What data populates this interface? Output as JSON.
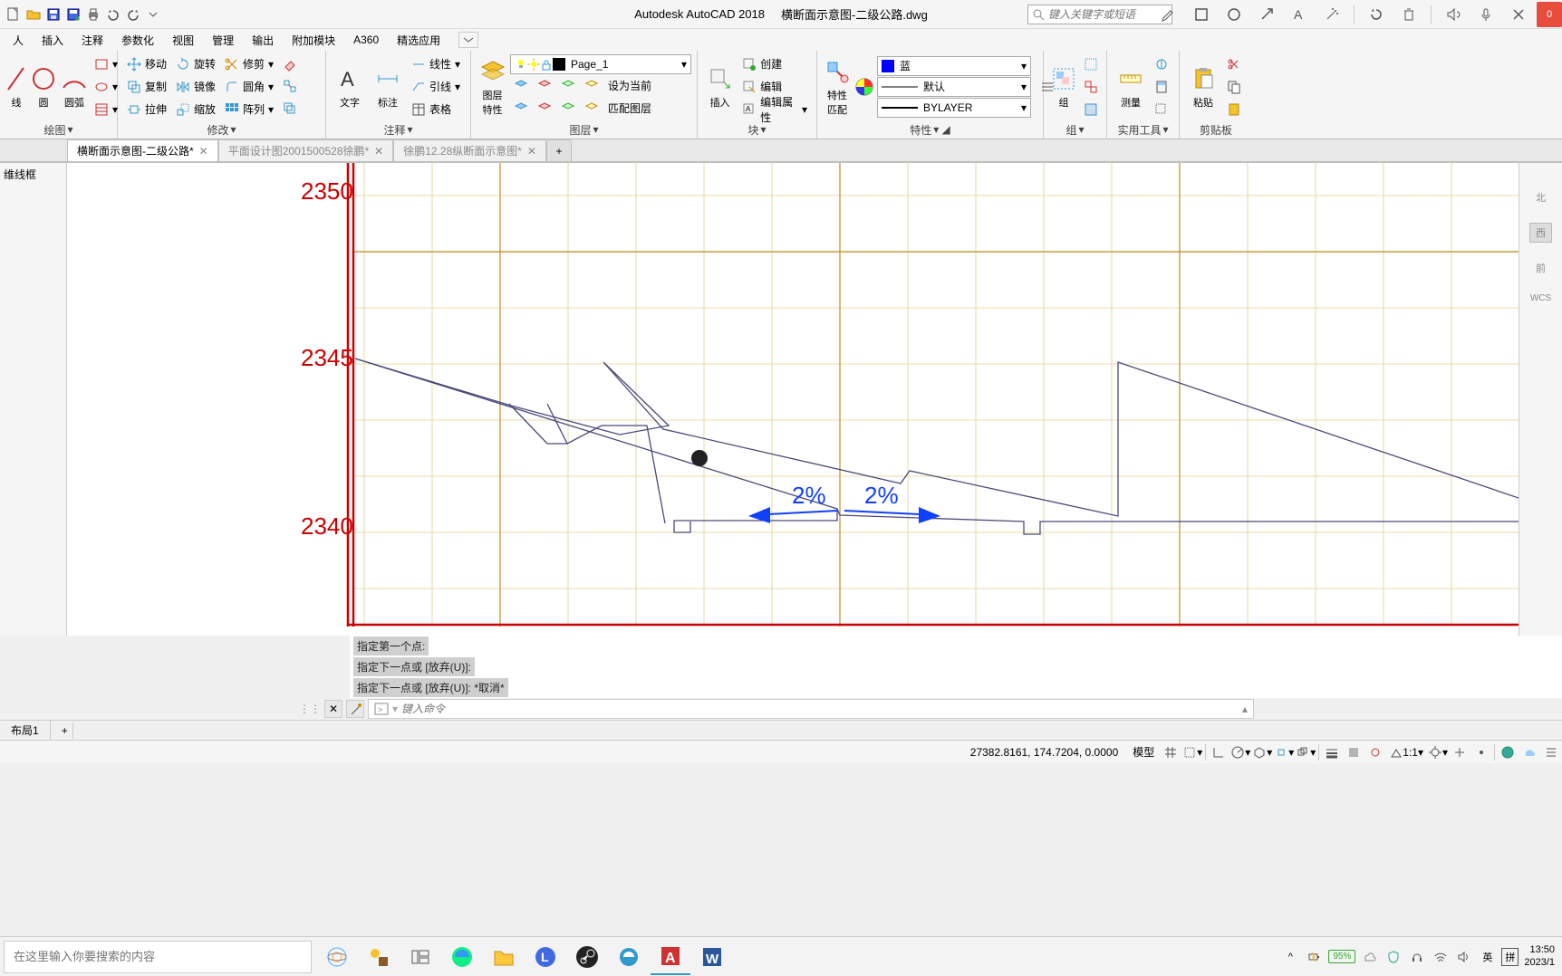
{
  "title": {
    "app": "Autodesk AutoCAD 2018",
    "doc": "横断面示意图-二级公路.dwg"
  },
  "search_placeholder": "键入关键字或短语",
  "badge": "0",
  "menu": [
    "人",
    "插入",
    "注释",
    "参数化",
    "视图",
    "管理",
    "输出",
    "附加模块",
    "A360",
    "精选应用"
  ],
  "ribbon": {
    "draw": {
      "title": "绘图",
      "line": "线",
      "circle": "圆",
      "arc": "圆弧"
    },
    "modify": {
      "title": "修改",
      "items": [
        "移动",
        "旋转",
        "修剪",
        "复制",
        "镜像",
        "圆角",
        "拉伸",
        "缩放",
        "阵列"
      ]
    },
    "annot": {
      "title": "注释",
      "text": "文字",
      "dim": "标注",
      "table": "表格",
      "xline": "线性",
      "leader": "引线"
    },
    "layer": {
      "title": "图层",
      "props": "图层\n特性",
      "items": [
        "设为当前",
        "匹配图层"
      ],
      "current": "Page_1"
    },
    "block": {
      "title": "块",
      "insert": "插入",
      "items": [
        "创建",
        "编辑",
        "编辑属性"
      ]
    },
    "props": {
      "title": "特性",
      "match": "特性\n匹配",
      "color": "蓝",
      "ltype": "默认",
      "lweight": "BYLAYER"
    },
    "group": {
      "title": "组",
      "label": "组"
    },
    "util": {
      "title": "实用工具",
      "measure": "测量"
    },
    "clip": {
      "title": "剪贴板",
      "paste": "粘贴"
    }
  },
  "tabs": [
    {
      "label": "横断面示意图-二级公路*",
      "active": true
    },
    {
      "label": "平面设计图2001500528徐鹏*",
      "active": false
    },
    {
      "label": "徐鹏12.28纵断面示意图*",
      "active": false
    }
  ],
  "sidepanel": "维线框",
  "nav": {
    "n": "北",
    "w": "西",
    "hint": "前",
    "wcs": "WCS"
  },
  "axis_labels": [
    "2350",
    "2345",
    "2340"
  ],
  "drawing": {
    "slope_left": "2%",
    "slope_right": "2%"
  },
  "cmd_history": [
    "指定第一个点:",
    "指定下一点或 [放弃(U)]:",
    "指定下一点或 [放弃(U)]: *取消*"
  ],
  "cmd_placeholder": "键入命令",
  "layout_tab": "布局1",
  "status": {
    "coords": "27382.8161, 174.7204, 0.0000",
    "space": "模型",
    "scale": "1:1"
  },
  "taskbar": {
    "search": "在这里输入你要搜索的内容",
    "battery": "95%",
    "ime1": "英",
    "ime2": "拼",
    "time": "13:50",
    "date": "2023/1"
  }
}
